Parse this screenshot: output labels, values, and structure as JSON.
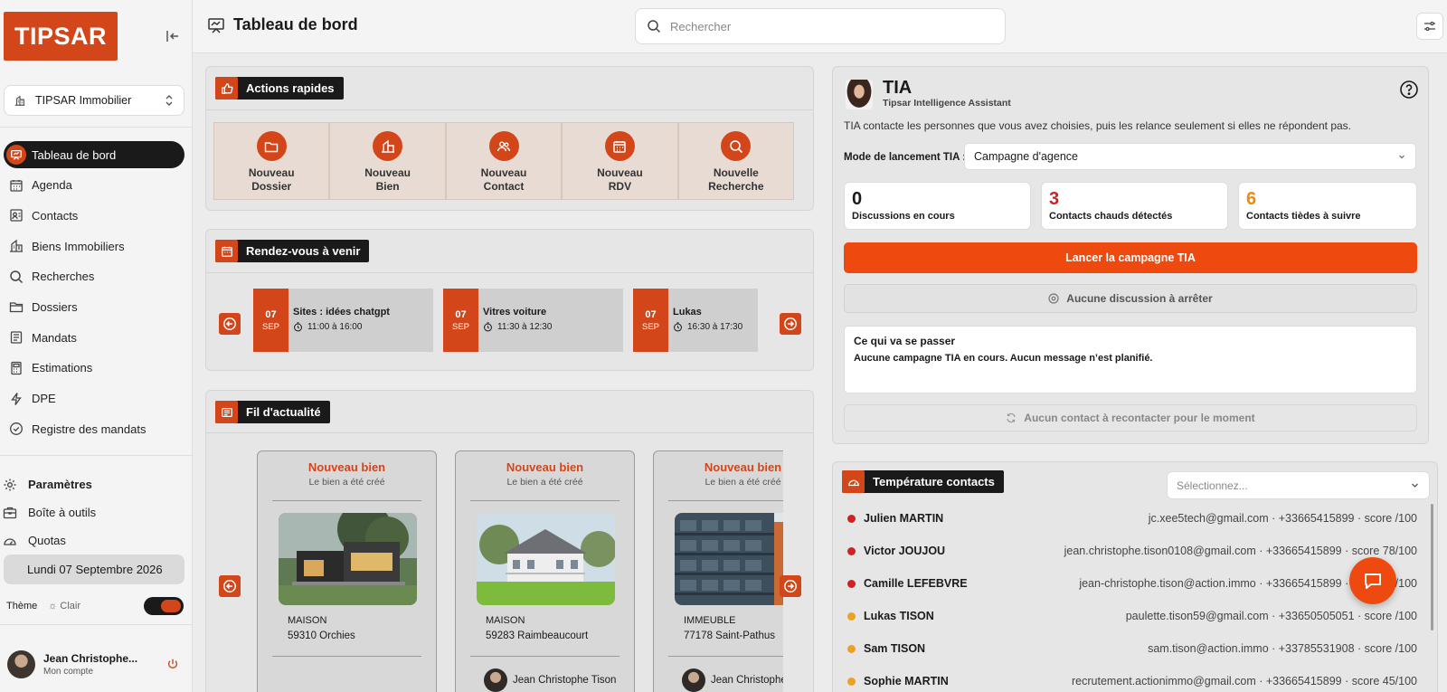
{
  "brand": {
    "logo_text": "TIPSAR",
    "accent": "#d2461a"
  },
  "agency": {
    "name": "TIPSAR Immobilier"
  },
  "sidebar": {
    "items": [
      {
        "label": "Tableau de bord",
        "icon": "dashboard-icon",
        "active": true
      },
      {
        "label": "Agenda",
        "icon": "calendar-icon"
      },
      {
        "label": "Contacts",
        "icon": "contacts-icon"
      },
      {
        "label": "Biens Immobiliers",
        "icon": "building-icon"
      },
      {
        "label": "Recherches",
        "icon": "search-icon"
      },
      {
        "label": "Dossiers",
        "icon": "folder-icon"
      },
      {
        "label": "Mandats",
        "icon": "document-icon"
      },
      {
        "label": "Estimations",
        "icon": "calculator-icon"
      },
      {
        "label": "DPE",
        "icon": "lightning-icon"
      },
      {
        "label": "Registre des mandats",
        "icon": "check-circle-icon"
      }
    ],
    "bottom": {
      "settings": "Paramètres",
      "toolbox": "Boîte à outils",
      "quotas": "Quotas"
    },
    "date": "Lundi 07 Septembre 2026",
    "theme": {
      "label": "Thème",
      "mode": "☼ Clair"
    },
    "user": {
      "name": "Jean Christophe...",
      "sub": "Mon compte"
    }
  },
  "header": {
    "title": "Tableau de bord",
    "search_placeholder": "Rechercher"
  },
  "quick_actions": {
    "title": "Actions rapides",
    "items": [
      {
        "line1": "Nouveau",
        "line2": "Dossier",
        "icon": "folder-icon"
      },
      {
        "line1": "Nouveau",
        "line2": "Bien",
        "icon": "building-icon"
      },
      {
        "line1": "Nouveau",
        "line2": "Contact",
        "icon": "contacts-icon"
      },
      {
        "line1": "Nouveau",
        "line2": "RDV",
        "icon": "calendar-icon"
      },
      {
        "line1": "Nouvelle",
        "line2": "Recherche",
        "icon": "search-icon"
      }
    ]
  },
  "rdv": {
    "title": "Rendez-vous à venir",
    "items": [
      {
        "day": "07",
        "month": "SEP",
        "title": "Sites : idées chatgpt",
        "time": "11:00 à 16:00"
      },
      {
        "day": "07",
        "month": "SEP",
        "title": "Vitres voiture",
        "time": "11:30 à 12:30"
      },
      {
        "day": "07",
        "month": "SEP",
        "title": "Lukas",
        "time": "16:30 à 17:30"
      }
    ]
  },
  "feed": {
    "title": "Fil d'actualité",
    "items": [
      {
        "title": "Nouveau bien",
        "sub": "Le bien a été créé",
        "type": "MAISON",
        "location": "59310 Orchies",
        "agent": ""
      },
      {
        "title": "Nouveau bien",
        "sub": "Le bien a été créé",
        "type": "MAISON",
        "location": "59283 Raimbeaucourt",
        "agent": "Jean Christophe Tison"
      },
      {
        "title": "Nouveau bien",
        "sub": "Le bien a été créé",
        "type": "IMMEUBLE",
        "location": "77178 Saint-Pathus",
        "agent": "Jean Christophe Tison"
      }
    ]
  },
  "tia": {
    "name": "TIA",
    "subtitle": "Tipsar Intelligence Assistant",
    "description": "TIA contacte les personnes que vous avez choisies, puis les relance seulement si elles ne répondent pas.",
    "mode_label": "Mode de lancement TIA :",
    "mode_value": "Campagne d'agence",
    "stats": [
      {
        "value": "0",
        "label": "Discussions en cours",
        "color": "#1a1a1a"
      },
      {
        "value": "3",
        "label": "Contacts chauds détectés",
        "color": "#d42020"
      },
      {
        "value": "6",
        "label": "Contacts tièdes à suivre",
        "color": "#ee8a10"
      }
    ],
    "launch_label": "Lancer la campagne TIA",
    "stop_label": "Aucune discussion à arrêter",
    "plan_title": "Ce qui va se passer",
    "plan_text": "Aucune campagne TIA en cours. Aucun message n’est planifié.",
    "recall_label": "Aucun contact à recontacter pour le moment"
  },
  "temperature": {
    "title": "Température contacts",
    "select_placeholder": "Sélectionnez...",
    "contacts": [
      {
        "name": "Julien MARTIN",
        "meta": "jc.xee5tech@gmail.com · +33665415899 · score /100",
        "color": "#d42020"
      },
      {
        "name": "Victor JOUJOU",
        "meta": "jean.christophe.tison0108@gmail.com · +33665415899 · score 78/100",
        "color": "#d42020"
      },
      {
        "name": "Camille LEFEBVRE",
        "meta": "jean-christophe.tison@action.immo · +33665415899 · score 70/100",
        "color": "#d42020"
      },
      {
        "name": "Lukas TISON",
        "meta": "paulette.tison59@gmail.com · +33650505051 · score /100",
        "color": "#f0a020"
      },
      {
        "name": "Sam TISON",
        "meta": "sam.tison@action.immo · +33785531908 · score /100",
        "color": "#f0a020"
      },
      {
        "name": "Sophie MARTIN",
        "meta": "recrutement.actionimmo@gmail.com · +33665415899 · score 45/100",
        "color": "#f0a020"
      }
    ]
  }
}
